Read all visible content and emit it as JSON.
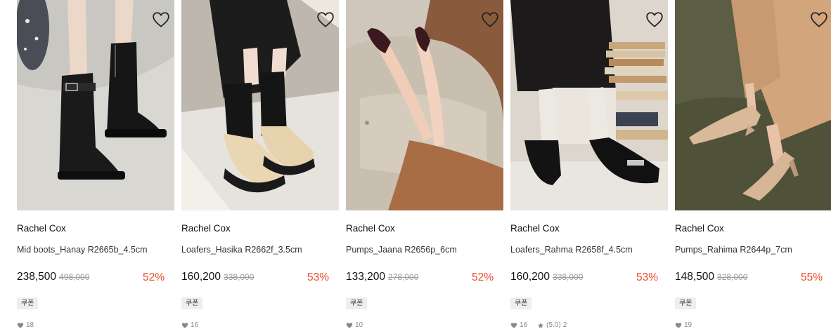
{
  "products": [
    {
      "brand": "Rachel Cox",
      "name": "Mid boots_Hanay R2665b_4.5cm",
      "price": "238,500",
      "original_price": "498,000",
      "discount": "52%",
      "coupon_label": "쿠폰",
      "likes": "18",
      "rating": "",
      "reviews": ""
    },
    {
      "brand": "Rachel Cox",
      "name": "Loafers_Hasika R2662f_3.5cm",
      "price": "160,200",
      "original_price": "338,000",
      "discount": "53%",
      "coupon_label": "쿠폰",
      "likes": "16",
      "rating": "",
      "reviews": ""
    },
    {
      "brand": "Rachel Cox",
      "name": "Pumps_Jaana R2656p_6cm",
      "price": "133,200",
      "original_price": "278,000",
      "discount": "52%",
      "coupon_label": "쿠폰",
      "likes": "10",
      "rating": "",
      "reviews": ""
    },
    {
      "brand": "Rachel Cox",
      "name": "Loafers_Rahma R2658f_4.5cm",
      "price": "160,200",
      "original_price": "338,000",
      "discount": "53%",
      "coupon_label": "쿠폰",
      "likes": "16",
      "rating": "(5.0)",
      "reviews": "2"
    },
    {
      "brand": "Rachel Cox",
      "name": "Pumps_Rahima R2644p_7cm",
      "price": "148,500",
      "original_price": "328,000",
      "discount": "55%",
      "coupon_label": "쿠폰",
      "likes": "19",
      "rating": "",
      "reviews": ""
    }
  ],
  "colors": {
    "discount": "#ef4b2a",
    "coupon_bg": "#eeeeee",
    "meta": "#888888"
  },
  "icons": {
    "wishlist": "heart-outline-icon",
    "like_count": "heart-filled-icon",
    "rating": "star-icon"
  }
}
